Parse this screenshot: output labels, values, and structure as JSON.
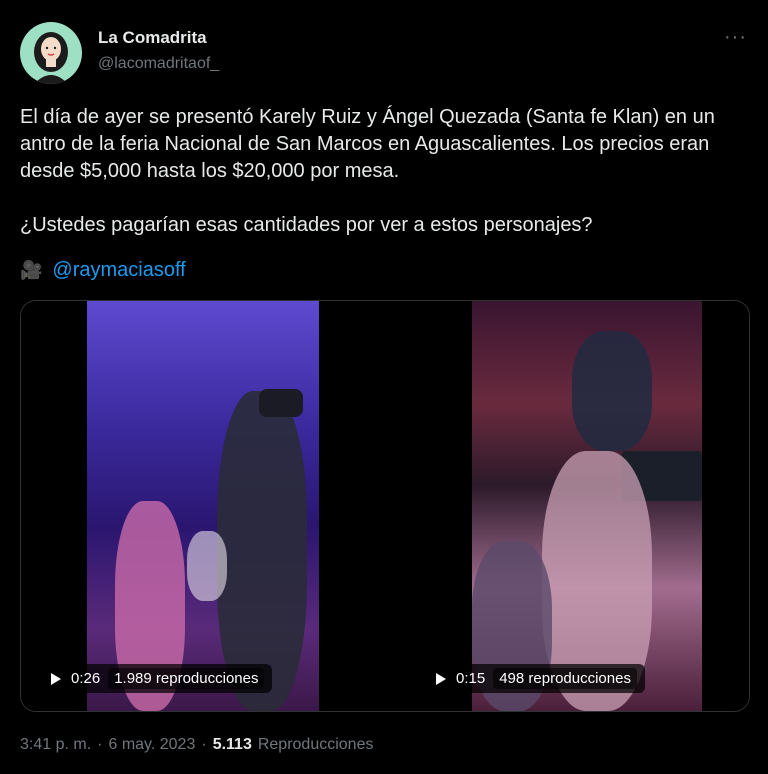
{
  "author": {
    "name": "La Comadrita",
    "handle": "@lacomadritaof_"
  },
  "more_label": "···",
  "tweet": {
    "paragraph1": "El día de ayer se presentó Karely Ruiz y Ángel Quezada (Santa fe Klan) en un antro de la feria Nacional de San Marcos en Aguascalientes. Los precios eran desde $5,000 hasta los $20,000 por mesa.",
    "paragraph2": "¿Ustedes pagarían esas cantidades por ver a estos personajes?",
    "credit_icon": "🎥",
    "credit_link": "@raymaciasoff"
  },
  "videos": [
    {
      "duration": "0:26",
      "views": "1.989 reproducciones"
    },
    {
      "duration": "0:15",
      "views": "498 reproducciones"
    }
  ],
  "footer": {
    "time": "3:41 p. m.",
    "sep1": "·",
    "date": "6 may. 2023",
    "sep2": "·",
    "view_count": "5.113",
    "view_label": "Reproducciones"
  },
  "colors": {
    "link": "#1d9bf0",
    "text": "#e7e9ea",
    "muted": "#71767b",
    "avatar_bg": "#9ee0c4"
  }
}
